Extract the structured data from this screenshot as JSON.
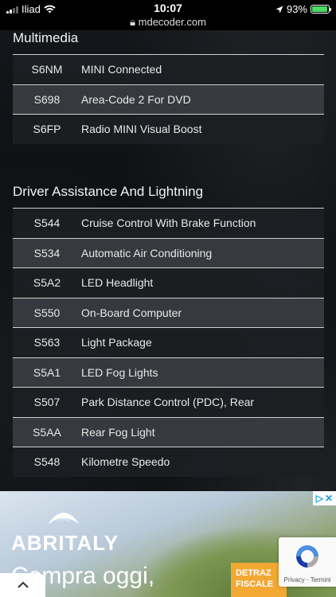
{
  "statusbar": {
    "carrier": "Iliad",
    "time": "10:07",
    "url": "mdecoder.com",
    "battery": "93%",
    "battery_level": 0.93
  },
  "sections": [
    {
      "title": "Multimedia",
      "rows": [
        {
          "code": "S6NM",
          "desc": "MINI Connected"
        },
        {
          "code": "S698",
          "desc": "Area-Code 2 For DVD"
        },
        {
          "code": "S6FP",
          "desc": "Radio MINI Visual Boost"
        }
      ]
    },
    {
      "title": "Driver Assistance And Lightning",
      "rows": [
        {
          "code": "S544",
          "desc": "Cruise Control With Brake Function"
        },
        {
          "code": "S534",
          "desc": "Automatic Air Conditioning"
        },
        {
          "code": "S5A2",
          "desc": "LED Headlight"
        },
        {
          "code": "S550",
          "desc": "On-Board Computer"
        },
        {
          "code": "S563",
          "desc": "Light Package"
        },
        {
          "code": "S5A1",
          "desc": "LED Fog Lights"
        },
        {
          "code": "S507",
          "desc": "Park Distance Control (PDC), Rear"
        },
        {
          "code": "S5AA",
          "desc": "Rear Fog Light"
        },
        {
          "code": "S548",
          "desc": "Kilometre Speedo"
        }
      ]
    }
  ],
  "ad": {
    "brand": "ABRITALY",
    "headline": "Compra oggi,",
    "badge_line1": "DETRAZ",
    "badge_line2": "FISCALE",
    "recaptcha_terms": "Privacy - Termini"
  }
}
